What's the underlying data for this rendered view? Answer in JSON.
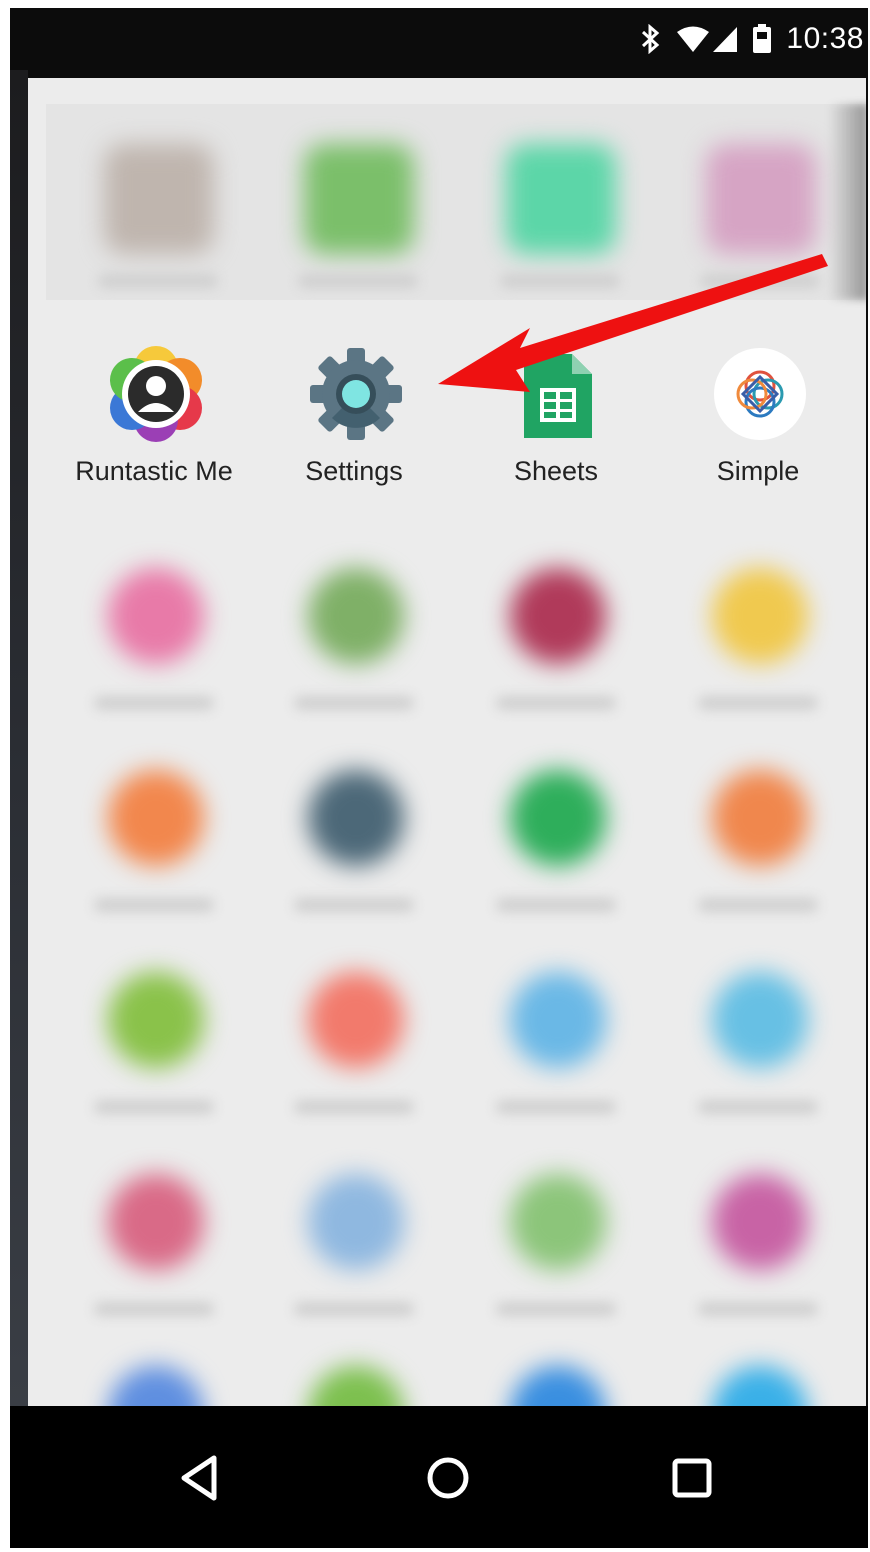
{
  "status_bar": {
    "time": "10:38",
    "icons": [
      "bluetooth-icon",
      "wifi-icon",
      "cell-signal-icon",
      "battery-icon"
    ]
  },
  "app_drawer": {
    "highlighted_row": [
      {
        "name": "Runtastic Me",
        "icon": "runtastic-me-icon"
      },
      {
        "name": "Settings",
        "icon": "gear-icon"
      },
      {
        "name": "Sheets",
        "icon": "sheets-icon"
      },
      {
        "name": "Simple",
        "icon": "simple-icon"
      }
    ],
    "blurred_rows": [
      [
        "#e87aa8",
        "#7fb067",
        "#b03a5a",
        "#f0c94f"
      ],
      [
        "#f2874d",
        "#4c6878",
        "#2eae5b",
        "#f0874d"
      ],
      [
        "#8ac24a",
        "#f27a6c",
        "#6ab8e6",
        "#67c0e4"
      ],
      [
        "#d96a87",
        "#8fb8e0",
        "#8cc57a",
        "#c863a5"
      ],
      [
        "#5f8fe0",
        "#7dc04f",
        "#3a8fe0",
        "#3ab0e8"
      ]
    ],
    "top_row_colors": [
      "#bfb5ae",
      "#7bbf6a",
      "#5cd6a8",
      "#d6a4c4"
    ]
  },
  "annotation": {
    "arrow_color": "#ee1111",
    "points_to": "Settings"
  },
  "nav_bar": {
    "buttons": [
      "back-icon",
      "home-icon",
      "recents-icon"
    ]
  }
}
